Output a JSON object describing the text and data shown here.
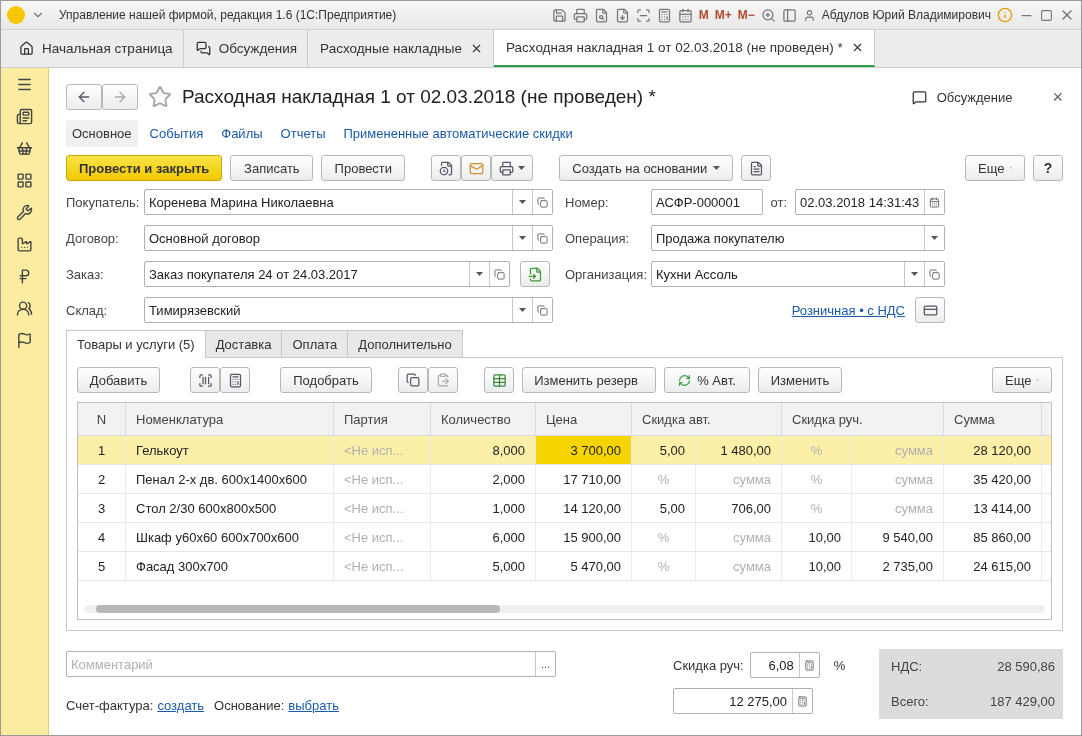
{
  "window": {
    "title": "Управление нашей фирмой, редакция 1.6  (1С:Предприятие)",
    "memory": [
      "M",
      "M+",
      "M−"
    ],
    "user": "Абдулов Юрий Владимирович"
  },
  "app_tabs": [
    {
      "label": "Начальная страница",
      "kind": "home",
      "selected": false,
      "closable": false
    },
    {
      "label": "Обсуждения",
      "kind": "chat",
      "selected": false,
      "closable": false
    },
    {
      "label": "Расходные накладные",
      "kind": "plain",
      "selected": false,
      "closable": true
    },
    {
      "label": "Расходная накладная 1 от 02.03.2018 (не проведен) *",
      "kind": "plain",
      "selected": true,
      "closable": true
    }
  ],
  "form": {
    "title": "Расходная накладная 1 от 02.03.2018 (не проведен) *",
    "discussion": "Обсуждение",
    "close": "×",
    "sections": [
      {
        "label": "Основное",
        "selected": true
      },
      {
        "label": "События",
        "selected": false
      },
      {
        "label": "Файлы",
        "selected": false
      },
      {
        "label": "Отчеты",
        "selected": false
      },
      {
        "label": "Примененные автоматические скидки",
        "selected": false
      }
    ],
    "toolbar": {
      "primary": "Провести и закрыть",
      "buttons": [
        "Записать",
        "Провести"
      ],
      "create_based": "Создать на основании",
      "more": "Еще",
      "help": "?"
    },
    "fields_left": [
      {
        "label": "Покупатель:",
        "value": "Коренева Марина Николаевна",
        "fill_button": false
      },
      {
        "label": "Договор:",
        "value": "Основной договор",
        "fill_button": false
      },
      {
        "label": "Заказ:",
        "value": "Заказ покупателя 24 от 24.03.2017",
        "fill_button": true
      },
      {
        "label": "Склад:",
        "value": "Тимирязевский",
        "fill_button": false
      }
    ],
    "number": {
      "label": "Номер:",
      "value": "АСФР-000001"
    },
    "date": {
      "label": "от:",
      "value": "02.03.2018 14:31:43"
    },
    "operation": {
      "label": "Операция:",
      "value": "Продажа покупателю"
    },
    "organization": {
      "label": "Организация:",
      "value": "Кухни Ассоль"
    },
    "price_link": "Розничная • с НДС",
    "doc_tabs": [
      {
        "label": "Товары и услуги (5)",
        "selected": true
      },
      {
        "label": "Доставка",
        "selected": false
      },
      {
        "label": "Оплата",
        "selected": false
      },
      {
        "label": "Дополнительно",
        "selected": false
      }
    ],
    "table_toolbar": {
      "add": "Добавить",
      "pick": "Подобрать",
      "reserve": "Изменить резерв",
      "auto": "% Авт.",
      "change": "Изменить",
      "more": "Еще"
    },
    "table": {
      "columns": [
        "N",
        "Номенклатура",
        "Партия",
        "Количество",
        "Цена",
        "Скидка авт.",
        "Скидка руч.",
        "Сумма"
      ],
      "rows": [
        {
          "n": "1",
          "name": "Гелькоут",
          "batch": "<Не исп...",
          "qty": "8,000",
          "price": "3 700,00",
          "auto_pct": "5,00",
          "auto_sum": "1 480,00",
          "auto_empty": false,
          "manual_pct": "%",
          "manual_sum": "сумма",
          "manual_empty": true,
          "sum": "28 120,00",
          "selected": true
        },
        {
          "n": "2",
          "name": "Пенал 2-х дв. 600х1400х600",
          "batch": "<Не исп...",
          "qty": "2,000",
          "price": "17 710,00",
          "auto_pct": "%",
          "auto_sum": "сумма",
          "auto_empty": true,
          "manual_pct": "%",
          "manual_sum": "сумма",
          "manual_empty": true,
          "sum": "35 420,00",
          "selected": false
        },
        {
          "n": "3",
          "name": "Стол 2/30 600х800х500",
          "batch": "<Не исп...",
          "qty": "1,000",
          "price": "14 120,00",
          "auto_pct": "5,00",
          "auto_sum": "706,00",
          "auto_empty": false,
          "manual_pct": "%",
          "manual_sum": "сумма",
          "manual_empty": true,
          "sum": "13 414,00",
          "selected": false
        },
        {
          "n": "4",
          "name": "Шкаф у60х60 600х700х600",
          "batch": "<Не исп...",
          "qty": "6,000",
          "price": "15 900,00",
          "auto_pct": "%",
          "auto_sum": "сумма",
          "auto_empty": true,
          "manual_pct": "10,00",
          "manual_sum": "9 540,00",
          "manual_empty": false,
          "sum": "85 860,00",
          "selected": false
        },
        {
          "n": "5",
          "name": "Фасад 300х700",
          "batch": "<Не исп...",
          "qty": "5,000",
          "price": "5 470,00",
          "auto_pct": "%",
          "auto_sum": "сумма",
          "auto_empty": true,
          "manual_pct": "10,00",
          "manual_sum": "2 735,00",
          "manual_empty": false,
          "sum": "24 615,00",
          "selected": false
        }
      ]
    },
    "comment": {
      "placeholder": "Комментарий",
      "button": "..."
    },
    "invoice": {
      "label": "Счет-фактура:",
      "link": "создать"
    },
    "basis": {
      "label": "Основание:",
      "link": "выбрать"
    },
    "manual_discount": {
      "label": "Скидка руч:",
      "percent": "6,08",
      "unit": "%",
      "amount": "12 275,00"
    },
    "totals": [
      {
        "label": "НДС:",
        "value": "28 590,86"
      },
      {
        "label": "Всего:",
        "value": "187 429,00"
      }
    ]
  }
}
